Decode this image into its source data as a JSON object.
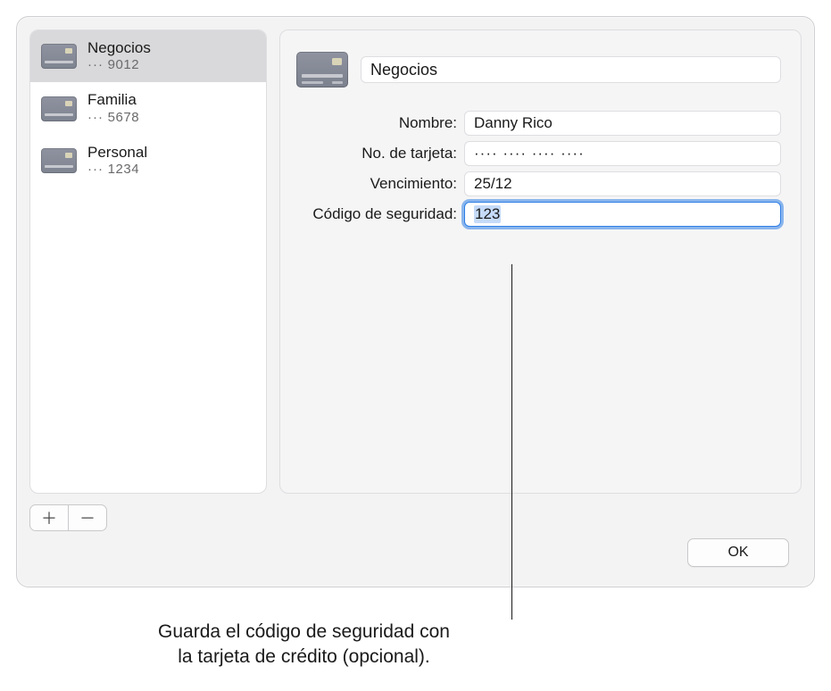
{
  "sidebar": {
    "items": [
      {
        "title": "Negocios",
        "masked_digits": "9012",
        "selected": true
      },
      {
        "title": "Familia",
        "masked_digits": "5678",
        "selected": false
      },
      {
        "title": "Personal",
        "masked_digits": "1234",
        "selected": false
      }
    ]
  },
  "detail": {
    "title_value": "Negocios",
    "fields": {
      "name": {
        "label": "Nombre:",
        "value": "Danny Rico"
      },
      "number": {
        "label": "No. de tarjeta:",
        "value": "···· ···· ···· ····"
      },
      "expiry": {
        "label": "Vencimiento:",
        "value": "25/12"
      },
      "cvv": {
        "label": "Código de seguridad:",
        "value": "123",
        "focused": true,
        "selected_text": true
      }
    }
  },
  "buttons": {
    "add": "＋",
    "remove": "－",
    "ok": "OK"
  },
  "callout": {
    "line1": "Guarda el código de seguridad con",
    "line2": "la tarjeta de crédito (opcional)."
  },
  "dot_prefix": "···"
}
